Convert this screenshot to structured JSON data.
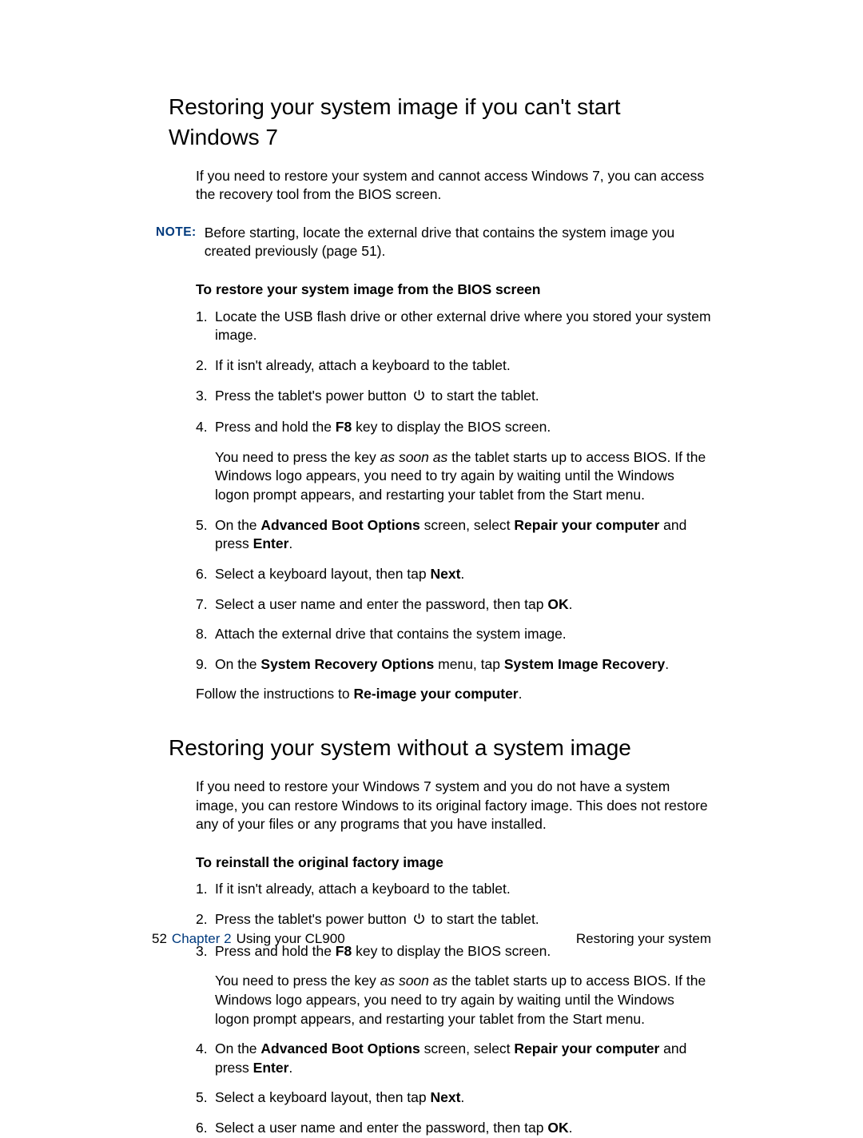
{
  "section1": {
    "heading": "Restoring your system image if you can't start Windows 7",
    "intro": "If you need to restore your system and cannot access Windows 7, you can access the recovery tool from the BIOS screen.",
    "note_label": "NOTE:",
    "note_body": "Before starting, locate the external drive that contains the system image you created previously (page 51).",
    "sub_heading": "To restore your system image from the BIOS screen",
    "step1": "Locate the USB flash drive or other external drive where you stored your system image.",
    "step2": "If it isn't already, attach a keyboard to the tablet.",
    "step3_a": "Press the tablet's power button ",
    "step3_b": " to start the tablet.",
    "step4_a": "Press and hold the ",
    "step4_b": "F8",
    "step4_c": " key to display the BIOS screen.",
    "step4_n1": "You need to press the key ",
    "step4_n2": "as soon as",
    "step4_n3": " the tablet starts up to access BIOS. If the Windows logo appears, you need to try again by waiting until the Windows logon prompt appears, and restarting your tablet from the Start menu.",
    "step5_a": "On the ",
    "step5_b": "Advanced Boot Options",
    "step5_c": " screen, select ",
    "step5_d": "Repair your computer",
    "step5_e": " and press ",
    "step5_f": "Enter",
    "step5_g": ".",
    "step6_a": "Select a keyboard layout, then tap ",
    "step6_b": "Next",
    "step6_c": ".",
    "step7_a": "Select a user name and enter the password, then tap ",
    "step7_b": "OK",
    "step7_c": ".",
    "step8": "Attach the external drive that contains the system image.",
    "step9_a": "On the ",
    "step9_b": "System Recovery Options",
    "step9_c": " menu, tap ",
    "step9_d": "System Image Recovery",
    "step9_e": ".",
    "follow_a": "Follow the instructions to ",
    "follow_b": "Re-image your computer",
    "follow_c": "."
  },
  "section2": {
    "heading": "Restoring your system without a system image",
    "intro": "If you need to restore your Windows 7 system and you do not have a system image, you can restore Windows to its original factory image. This does not restore any of your files or any programs that you have installed.",
    "sub_heading": "To reinstall the original factory image",
    "step1": "If it isn't already, attach a keyboard to the tablet.",
    "step2_a": "Press the tablet's power button ",
    "step2_b": " to start the tablet.",
    "step3_a": "Press and hold the ",
    "step3_b": "F8",
    "step3_c": " key to display the BIOS screen.",
    "step3_n1": "You need to press the key ",
    "step3_n2": "as soon as",
    "step3_n3": " the tablet starts up to access BIOS. If the Windows logo appears, you need to try again by waiting until the Windows logon prompt appears, and restarting your tablet from the Start menu.",
    "step4_a": "On the ",
    "step4_b": "Advanced Boot Options",
    "step4_c": " screen, select ",
    "step4_d": "Repair your computer",
    "step4_e": " and press ",
    "step4_f": "Enter",
    "step4_g": ".",
    "step5_a": "Select a keyboard layout, then tap ",
    "step5_b": "Next",
    "step5_c": ".",
    "step6_a": "Select a user name and enter the password, then tap ",
    "step6_b": "OK",
    "step6_c": "."
  },
  "footer": {
    "page": "52",
    "chapter": "Chapter 2",
    "chapter_title": "  Using your CL900",
    "right": "Restoring your system"
  }
}
